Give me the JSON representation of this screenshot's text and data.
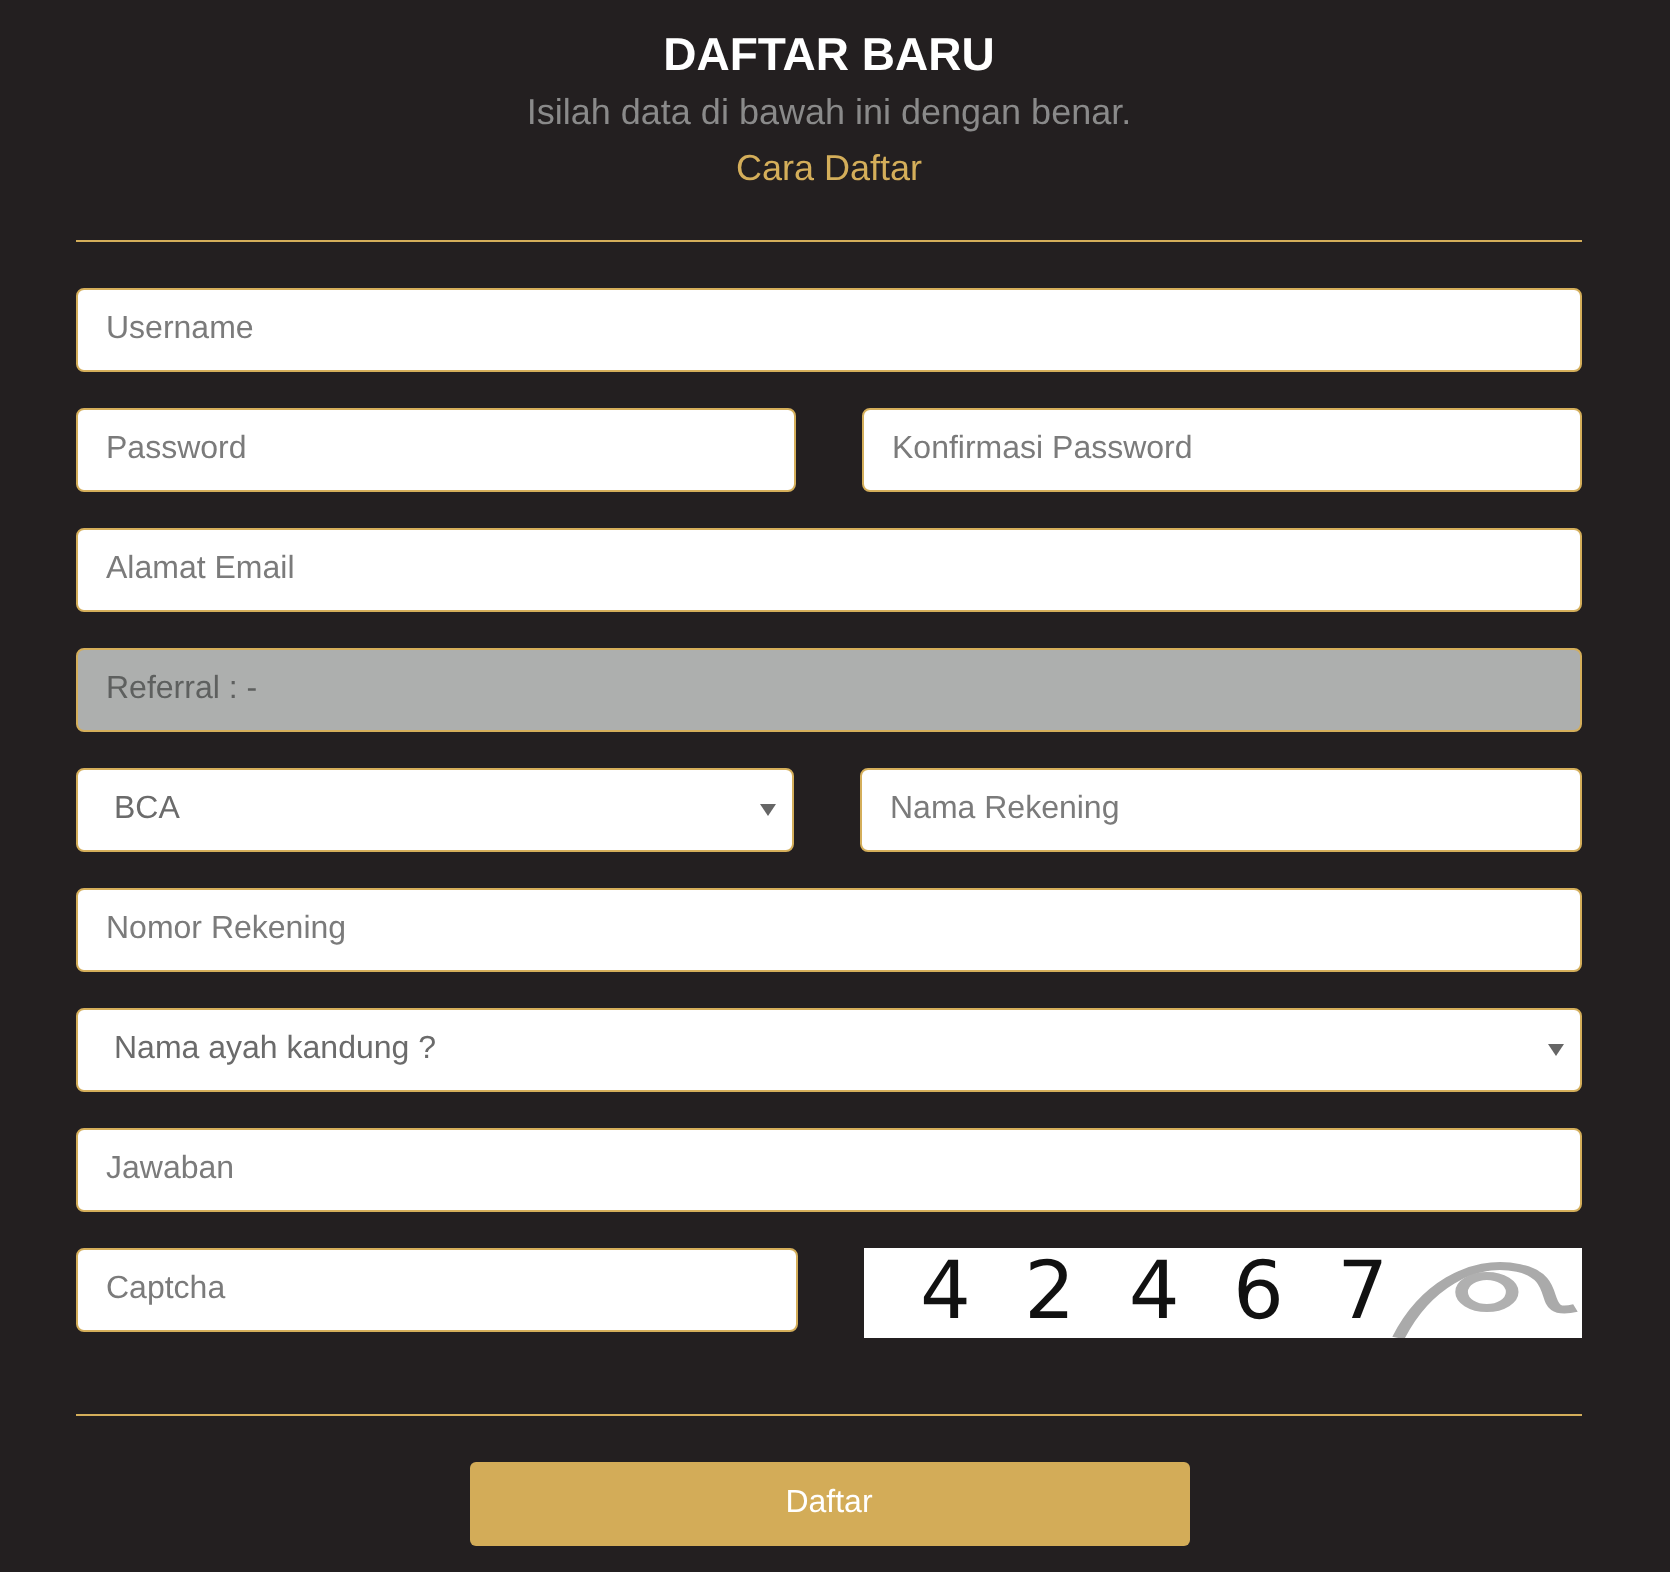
{
  "header": {
    "title": "DAFTAR BARU",
    "subtitle": "Isilah data di bawah ini dengan benar.",
    "link": "Cara Daftar"
  },
  "rows": [
    {
      "fields": [
        {
          "kind": "input",
          "placeholder": "Username"
        }
      ]
    },
    {
      "fields": [
        {
          "kind": "input",
          "placeholder": "Password"
        },
        {
          "kind": "input",
          "placeholder": "Konfirmasi Password"
        }
      ]
    },
    {
      "fields": [
        {
          "kind": "input",
          "placeholder": "Alamat Email"
        }
      ]
    },
    {
      "fields": [
        {
          "kind": "input",
          "placeholder": "Referral : -",
          "disabled": true
        }
      ]
    },
    {
      "fields": [
        {
          "kind": "select",
          "value": "BCA"
        },
        {
          "kind": "input",
          "placeholder": "Nama Rekening"
        }
      ]
    },
    {
      "fields": [
        {
          "kind": "input",
          "placeholder": "Nomor Rekening"
        }
      ]
    },
    {
      "fields": [
        {
          "kind": "select",
          "value": "Nama ayah kandung ?"
        }
      ]
    },
    {
      "fields": [
        {
          "kind": "input",
          "placeholder": "Jawaban"
        }
      ]
    },
    {
      "fields": [
        {
          "kind": "input",
          "placeholder": "Captcha"
        },
        {
          "kind": "captcha",
          "code": "4 2 4 6 7"
        }
      ]
    }
  ],
  "submit": "Daftar"
}
